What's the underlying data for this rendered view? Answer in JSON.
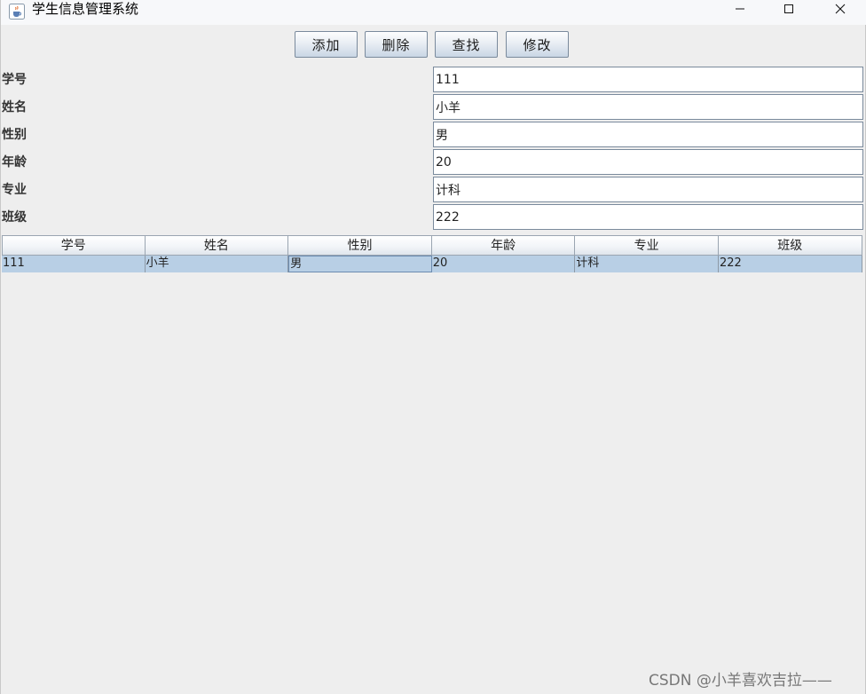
{
  "window": {
    "title": "学生信息管理系统",
    "app_icon": "java-cup-icon",
    "controls": {
      "minimize_icon": "minimize-icon",
      "maximize_icon": "maximize-icon",
      "close_icon": "close-icon"
    }
  },
  "toolbar": {
    "add_label": "添加",
    "delete_label": "删除",
    "search_label": "查找",
    "edit_label": "修改"
  },
  "form": {
    "fields": [
      {
        "label": "学号",
        "value": "111"
      },
      {
        "label": "姓名",
        "value": "小羊"
      },
      {
        "label": "性别",
        "value": "男"
      },
      {
        "label": "年龄",
        "value": "20"
      },
      {
        "label": "专业",
        "value": "计科"
      },
      {
        "label": "班级",
        "value": "222"
      }
    ]
  },
  "table": {
    "columns": [
      "学号",
      "姓名",
      "性别",
      "年龄",
      "专业",
      "班级"
    ],
    "rows": [
      [
        "111",
        "小羊",
        "男",
        "20",
        "计科",
        "222"
      ]
    ]
  },
  "watermark": "CSDN @小羊喜欢吉拉——",
  "colors": {
    "selected_row": "#b8cfe5",
    "background": "#eeeeee"
  }
}
